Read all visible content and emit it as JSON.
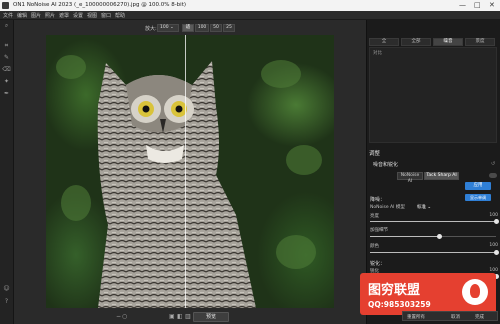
{
  "window": {
    "title": "ON1 NoNoise AI 2023 (_e_100000006270).jpg @ 100.0% 8-bit)",
    "controls": [
      "—",
      "□",
      "✕"
    ]
  },
  "menu": [
    "文件",
    "编辑",
    "图片",
    "照片",
    "遮罩",
    "设置",
    "视图",
    "窗口",
    "帮助"
  ],
  "viewbar": {
    "zoom_label": "放大:",
    "zoom_value": "100",
    "buttons": [
      "适",
      "100",
      "50",
      "25"
    ]
  },
  "left_tools": [
    "crop-icon",
    "brush-icon",
    "eraser-icon",
    "retouch-icon",
    "pen-icon",
    "magnify-icon"
  ],
  "left_tools_bottom": [
    "user-icon",
    "help-icon"
  ],
  "bottom": {
    "preview_label": "预览"
  },
  "right_panel": {
    "tabs": [
      "全",
      "全部",
      "噪音",
      "景度"
    ],
    "active_tab": 2,
    "preset_hint": "对比",
    "section_title": "调整",
    "subsection_title": "噪音和锐化",
    "modes": [
      "NoNoise AI",
      "Tack Sharp AI"
    ],
    "apply_label": "应用",
    "apply_sub_label": "显示单调",
    "noise": {
      "title": "降噪：",
      "model_label": "NoNoise AI 模型",
      "model_value": "标准",
      "rows": [
        {
          "label": "亮度",
          "value": "100",
          "level": 1.0
        },
        {
          "label": "加强细节",
          "value": "",
          "level": 0.55
        },
        {
          "label": "颜色",
          "value": "100",
          "level": 1.0
        }
      ]
    },
    "sharpen": {
      "title": "锐化：",
      "rows": [
        {
          "label": "锐化",
          "value": "100",
          "level": 1.0
        }
      ]
    },
    "bottom_buttons": [
      "重置所有",
      "取消",
      "完成"
    ]
  },
  "watermark": {
    "brand": "图穷联盟",
    "qq": "QQ:985303259",
    "colors": {
      "bg": "#e54030",
      "fg": "#ffffff"
    }
  }
}
